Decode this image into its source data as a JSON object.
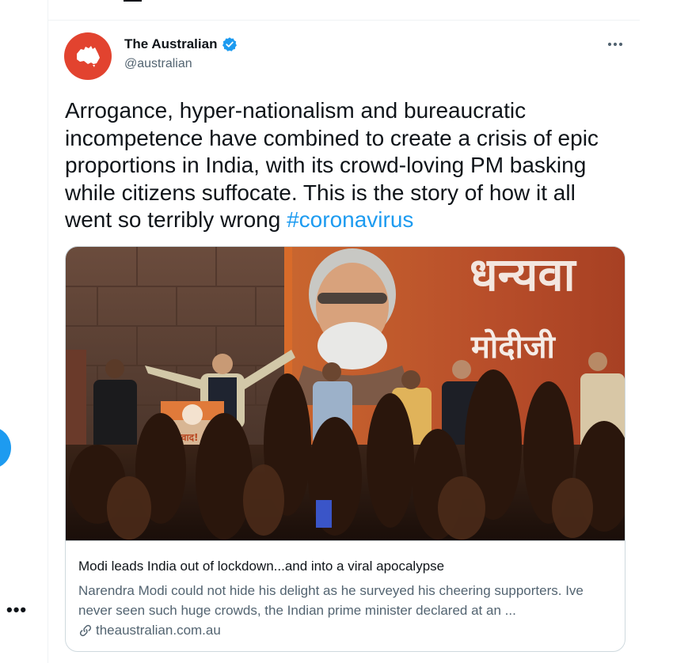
{
  "left_rail": {
    "more_label": "•••"
  },
  "tweet": {
    "author": {
      "display_name": "The Australian",
      "handle": "@australian",
      "verified": true,
      "avatar_color": "#e2432f"
    },
    "text": "Arrogance, hyper-nationalism and bureaucratic incompetence have combined to create a crisis of epic proportions in India, with its crowd-loving PM basking while citizens suffocate. This is the story of how it all went so terribly wrong ",
    "hashtag": "#coronavirus",
    "card": {
      "title": "Modi leads India out of lockdown...and into a viral apocalypse",
      "description": "Narendra Modi could not hide his delight as he surveyed his cheering supporters. Ive never seen such huge crowds, the Indian prime minister declared at an ...",
      "domain": "theaustralian.com.au",
      "image": {
        "banner_text_top": "धन्यवा",
        "banner_text_mid": "मोदीजी",
        "podium_text": "धन्यवाद!"
      }
    }
  },
  "colors": {
    "accent": "#1d9bf0",
    "secondary_text": "#536471",
    "border": "#cfd9de"
  }
}
